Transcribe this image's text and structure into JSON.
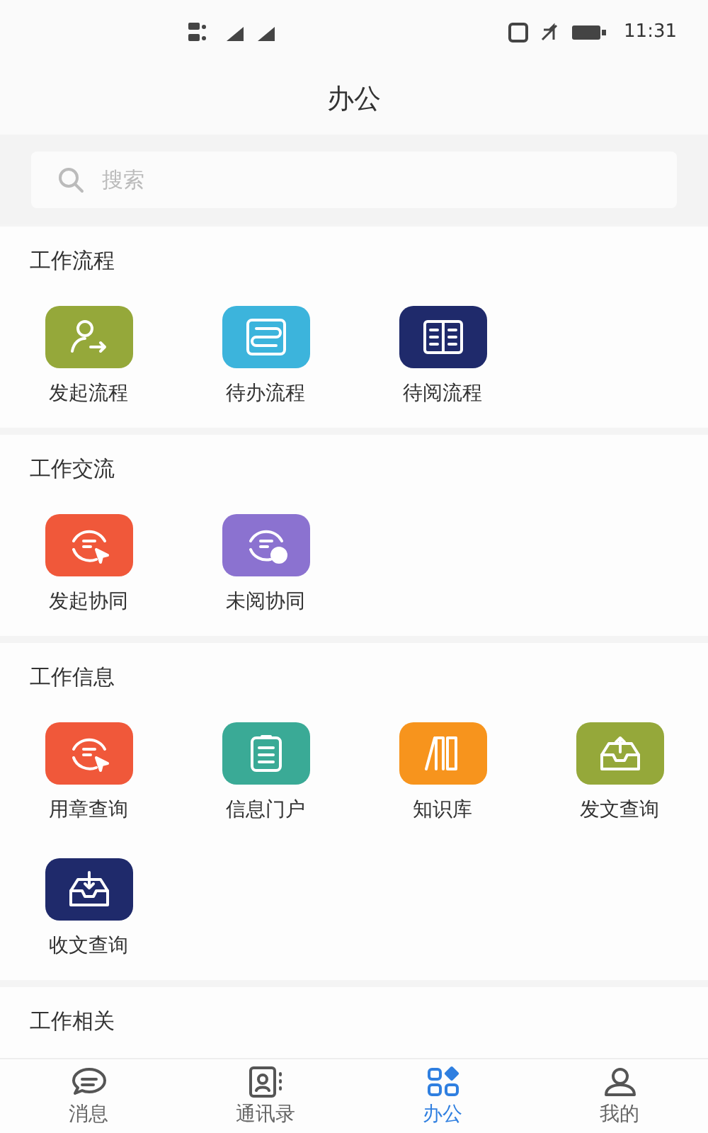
{
  "status_bar": {
    "time": "11:31"
  },
  "title": "办公",
  "search": {
    "placeholder": "搜索"
  },
  "sections": [
    {
      "title": "工作流程",
      "items": [
        {
          "label": "发起流程",
          "kind": "person-arrow",
          "color": "#95a83a"
        },
        {
          "label": "待办流程",
          "kind": "flow",
          "color": "#3cb4dc"
        },
        {
          "label": "待阅流程",
          "kind": "book",
          "color": "#1f2a6b"
        }
      ]
    },
    {
      "title": "工作交流",
      "items": [
        {
          "label": "发起协同",
          "kind": "cycle-send",
          "color": "#f0583a"
        },
        {
          "label": "未阅协同",
          "kind": "cycle-info",
          "color": "#8b72d0"
        }
      ]
    },
    {
      "title": "工作信息",
      "items": [
        {
          "label": "用章查询",
          "kind": "cycle-send",
          "color": "#f0583a"
        },
        {
          "label": "信息门户",
          "kind": "clipboard",
          "color": "#3aaa96"
        },
        {
          "label": "知识库",
          "kind": "books",
          "color": "#f7941d"
        },
        {
          "label": "发文查询",
          "kind": "tray-up",
          "color": "#95a83a"
        },
        {
          "label": "收文查询",
          "kind": "tray-down",
          "color": "#1f2a6b"
        }
      ]
    },
    {
      "title": "工作相关"
    }
  ],
  "tabs": [
    {
      "label": "消息",
      "kind": "chat",
      "selected": false
    },
    {
      "label": "通讯录",
      "kind": "contacts",
      "selected": false
    },
    {
      "label": "办公",
      "kind": "apps",
      "selected": true
    },
    {
      "label": "我的",
      "kind": "user",
      "selected": false
    }
  ]
}
